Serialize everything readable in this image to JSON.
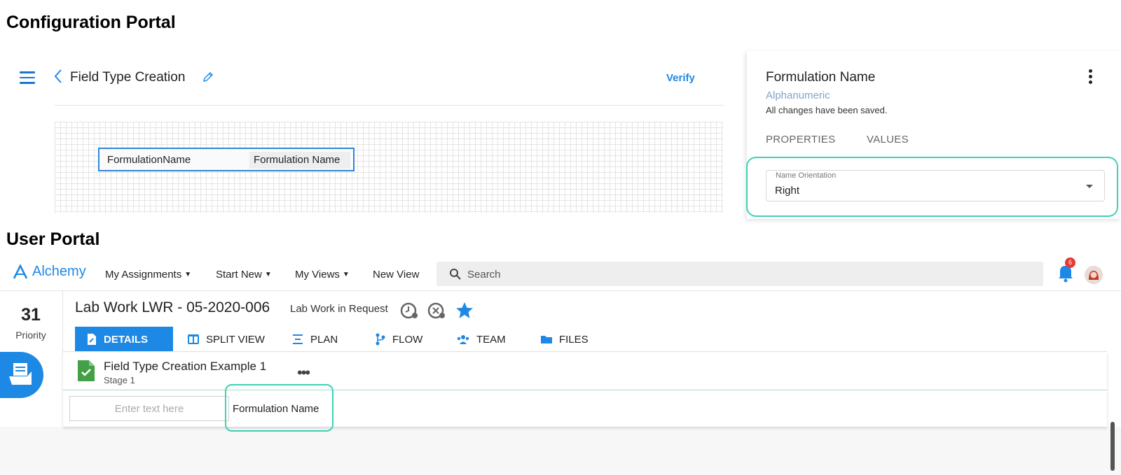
{
  "sections": {
    "config_title": "Configuration Portal",
    "user_title": "User Portal"
  },
  "config": {
    "page_title": "Field Type Creation",
    "verify_label": "Verify",
    "field_preview": {
      "name": "FormulationName",
      "label": "Formulation Name"
    },
    "panel": {
      "title": "Formulation Name",
      "type": "Alphanumeric",
      "saved_status": "All changes have been saved.",
      "tabs": [
        "PROPERTIES",
        "VALUES"
      ],
      "orientation_label": "Name Orientation",
      "orientation_value": "Right"
    }
  },
  "user": {
    "brand": "Alchemy",
    "nav": [
      "My Assignments",
      "Start New",
      "My Views",
      "New View"
    ],
    "search_placeholder": "Search",
    "notification_count": "6",
    "priority_value": "31",
    "priority_label": "Priority",
    "record_title": "Lab Work LWR - 05-2020-006",
    "record_status": "Lab Work in Request",
    "tabs": [
      "DETAILS",
      "SPLIT VIEW",
      "PLAN",
      "FLOW",
      "TEAM",
      "FILES"
    ],
    "form": {
      "title": "Field Type Creation Example 1",
      "stage": "Stage 1",
      "more": "•••",
      "input_placeholder": "Enter text here",
      "field_label": "Formulation Name"
    }
  },
  "colors": {
    "accent": "#1e88e5",
    "highlight": "#3ed1b4",
    "badge": "#e53935"
  }
}
